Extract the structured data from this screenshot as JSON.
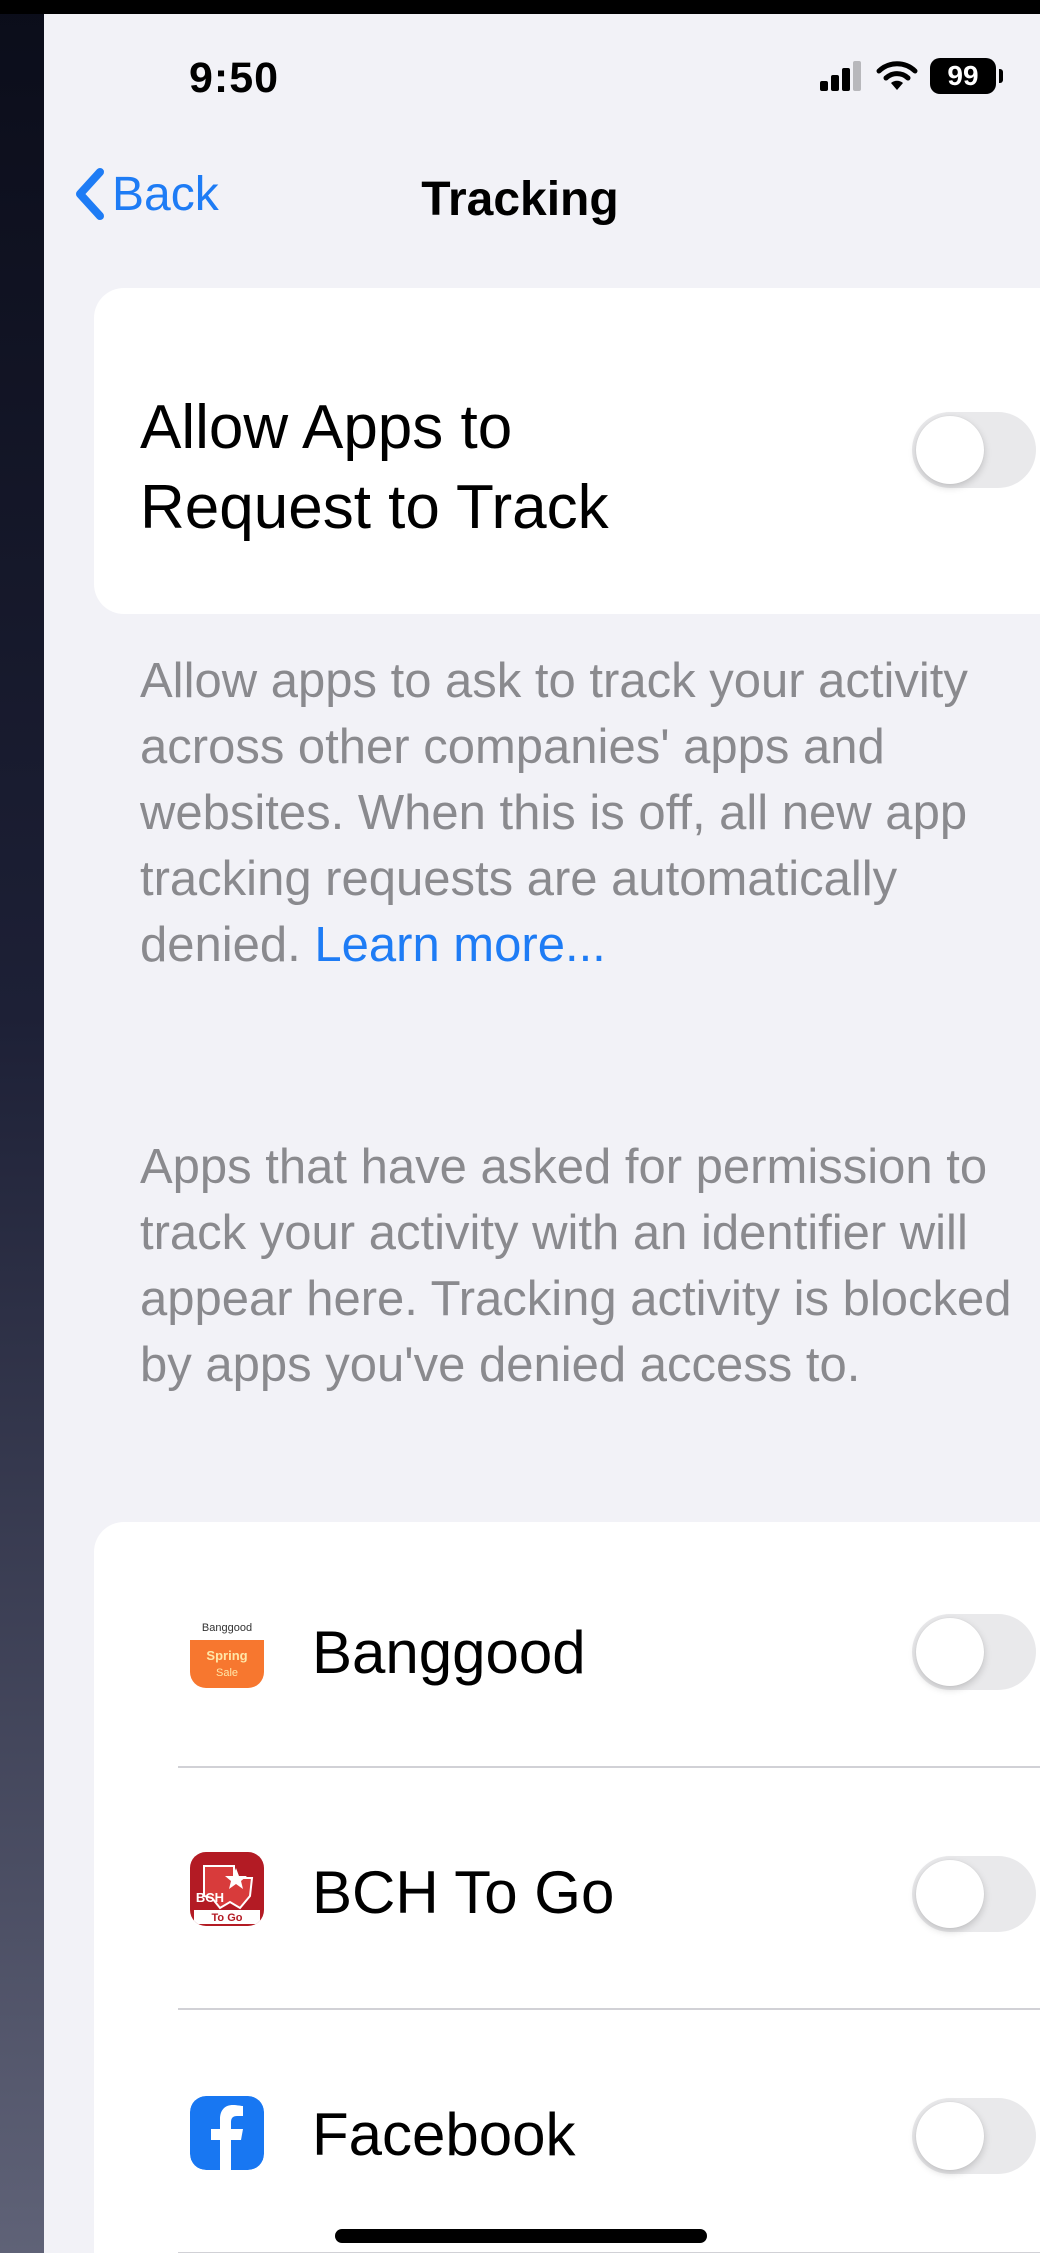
{
  "status_bar": {
    "time": "9:50",
    "battery": "99"
  },
  "nav": {
    "back_label": "Back",
    "title": "Tracking"
  },
  "main_setting": {
    "label": "Allow Apps to Request to Track",
    "enabled": false
  },
  "description": {
    "text": "Allow apps to ask to track your activity across other companies' apps and websites. When this is off, all new app tracking requests are automatically denied. ",
    "link": "Learn more..."
  },
  "info_text": "Apps that have asked for permission to track your activity with an identifier will appear here. Tracking activity is blocked by apps you've denied access to.",
  "apps": [
    {
      "name": "Banggood",
      "enabled": false,
      "icon": "banggood-icon",
      "icon_lines": [
        "Banggood",
        "Spring",
        "Sale"
      ]
    },
    {
      "name": "BCH To Go",
      "enabled": false,
      "icon": "bch-to-go-icon",
      "icon_lines": [
        "BCH",
        "To Go"
      ]
    },
    {
      "name": "Facebook",
      "enabled": false,
      "icon": "facebook-icon"
    }
  ],
  "colors": {
    "accent": "#1e7cf5",
    "background": "#f2f2f7",
    "toggle_off": "#e9e9eb",
    "secondary_text": "#8a8a8e"
  }
}
